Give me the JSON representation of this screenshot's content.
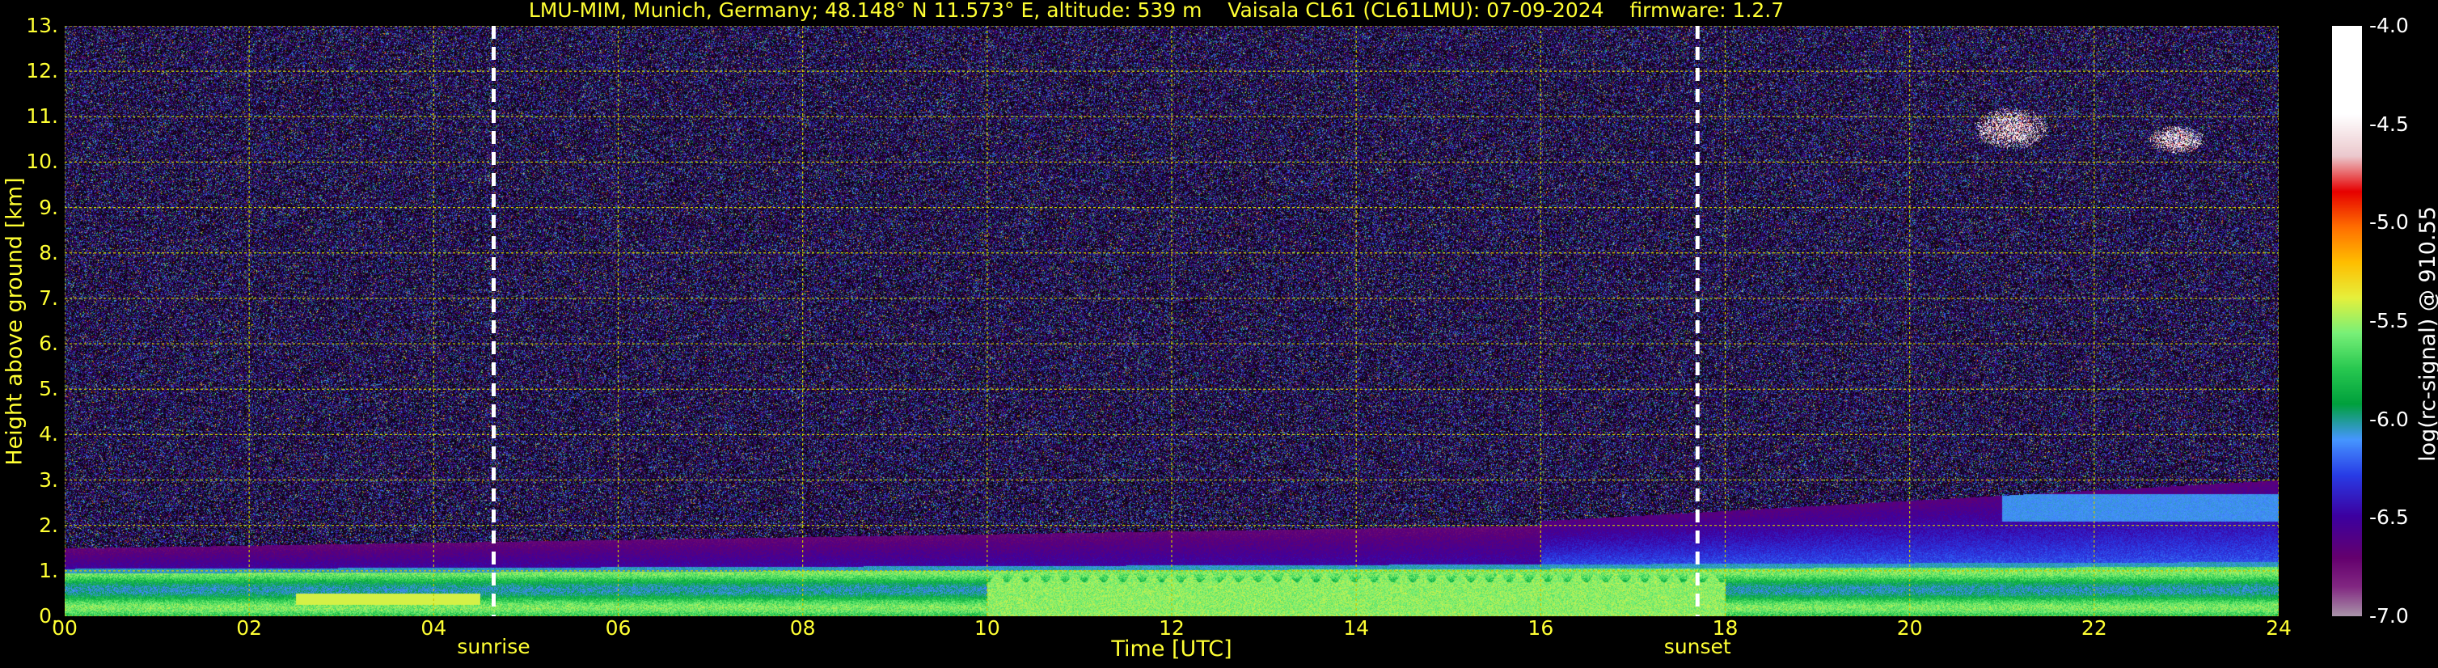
{
  "title": "LMU-MIM, Munich, Germany; 48.148° N 11.573° E, altitude: 539 m    Vaisala CL61 (CL61LMU): 07-09-2024    firmware: 1.2.7",
  "chart_data": {
    "type": "heatmap",
    "title": "LMU-MIM, Munich, Germany; 48.148° N 11.573° E, altitude: 539 m    Vaisala CL61 (CL61LMU): 07-09-2024    firmware: 1.2.7",
    "xlabel": "Time [UTC]",
    "ylabel": "Height above ground [km]",
    "xlim": [
      0,
      24
    ],
    "ylim": [
      0,
      13
    ],
    "x_ticks": [
      "00",
      "02",
      "04",
      "06",
      "08",
      "10",
      "12",
      "14",
      "16",
      "18",
      "20",
      "22",
      "24"
    ],
    "x_tick_values": [
      0,
      2,
      4,
      6,
      8,
      10,
      12,
      14,
      16,
      18,
      20,
      22,
      24
    ],
    "y_ticks": [
      "0.",
      "1.",
      "2.",
      "3.",
      "4.",
      "5.",
      "6.",
      "7.",
      "8.",
      "9.",
      "10.",
      "11.",
      "12.",
      "13."
    ],
    "y_tick_values": [
      0,
      1,
      2,
      3,
      4,
      5,
      6,
      7,
      8,
      9,
      10,
      11,
      12,
      13
    ],
    "grid": true,
    "markers": [
      {
        "label": "sunrise",
        "x": 4.65
      },
      {
        "label": "sunset",
        "x": 17.7
      }
    ],
    "colorbar": {
      "label": "log(rc-signal) @ 910.55 nm",
      "range": [
        -7.0,
        -4.0
      ],
      "ticks": [
        "-4.0",
        "-4.5",
        "-5.0",
        "-5.5",
        "-6.0",
        "-6.5",
        "-7.0"
      ],
      "tick_values": [
        -4.0,
        -4.5,
        -5.0,
        -5.5,
        -6.0,
        -6.5,
        -7.0
      ]
    },
    "layers": [
      {
        "name": "surface aerosol layer",
        "x": [
          0,
          24
        ],
        "y_top": [
          0.95,
          1.1
        ]
      },
      {
        "name": "residual layer",
        "x": [
          0,
          16
        ],
        "y_top": [
          1.5,
          2.0
        ]
      },
      {
        "name": "elevated layer",
        "x": [
          16,
          24
        ],
        "y_top": [
          2.1,
          3.0
        ]
      },
      {
        "name": "cloud",
        "x": [
          20.7,
          21.5
        ],
        "y": [
          10.3,
          11.2
        ]
      },
      {
        "name": "cloud",
        "x": [
          22.6,
          23.2
        ],
        "y": [
          10.2,
          10.8
        ]
      }
    ]
  },
  "colors": {
    "text": "#ffff33",
    "grid": "#c8c800",
    "marker": "#ffffff"
  }
}
